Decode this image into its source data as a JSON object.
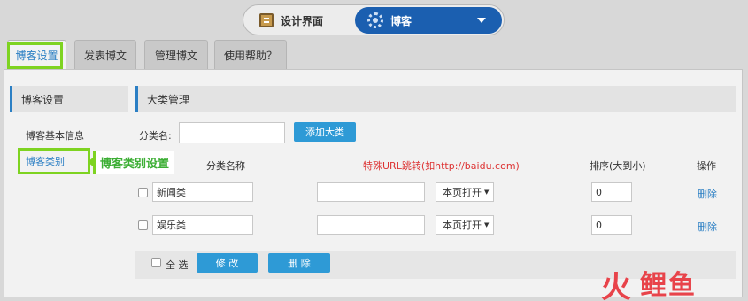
{
  "switcher": {
    "left_label": "设计界面",
    "right_label": "博客"
  },
  "tabs": [
    "博客设置",
    "发表博文",
    "管理博文",
    "使用帮助？"
  ],
  "sidebar": {
    "heading": "博客设置",
    "items": [
      "博客基本信息",
      "博客类别"
    ],
    "callout": "博客类别设置"
  },
  "content": {
    "heading": "大类管理",
    "category_label": "分类名:",
    "category_input": "",
    "add_button": "添加大类",
    "table_headers": {
      "name": "分类名称",
      "url": "特殊URL跳转(如http://baidu.com)",
      "order": "排序(大到小)",
      "action": "操作"
    },
    "rows": [
      {
        "name": "新闻类",
        "url": "",
        "open": "本页打开",
        "order": "0",
        "action": "删除"
      },
      {
        "name": "娱乐类",
        "url": "",
        "open": "本页打开",
        "order": "0",
        "action": "删除"
      }
    ],
    "select_all": "全 选",
    "modify_button": "修 改",
    "delete_button": "删 除"
  },
  "logo": {
    "glyph": "火",
    "text": "鲤鱼"
  },
  "colors": {
    "accent": "#2b7fc4",
    "button": "#2e9ad6",
    "highlight": "#7ed321",
    "callout_text": "#3cae34",
    "logo": "#e8434a"
  }
}
